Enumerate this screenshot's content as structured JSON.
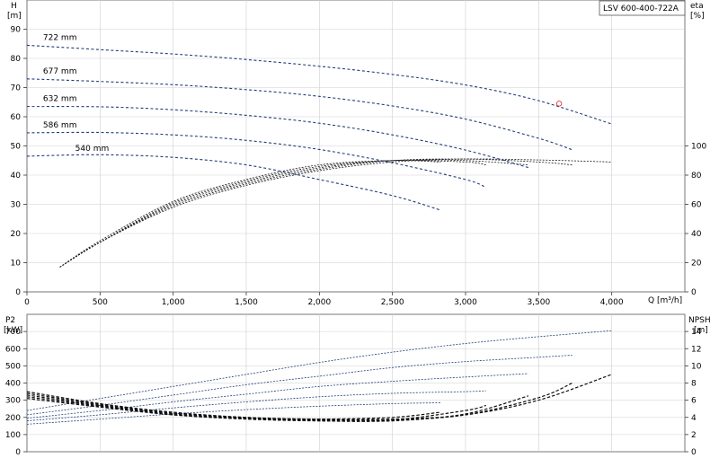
{
  "chart_data": [
    {
      "type": "line",
      "title": "LSV 600-400-722A",
      "ylabel_left": [
        "H",
        "[m]"
      ],
      "ylabel_right": [
        "eta",
        "[%]"
      ],
      "xlabel": "Q [m³/h]",
      "xlim": [
        0,
        4500
      ],
      "ylim_left": [
        0,
        100
      ],
      "ylim_right_ticks": [
        0,
        20,
        40,
        60,
        80,
        100
      ],
      "xticks": [
        0,
        500,
        1000,
        1500,
        2000,
        2500,
        3000,
        3500,
        4000
      ],
      "xtick_labels": [
        "0",
        "500",
        "1,000",
        "1,500",
        "2,000",
        "2,500",
        "3,000",
        "3,500",
        "4,000"
      ],
      "yticks_left": [
        0,
        10,
        20,
        30,
        40,
        50,
        60,
        70,
        80,
        90
      ],
      "grid": true,
      "head_series": [
        {
          "name": "722 mm",
          "color": "#1f3e7a",
          "x": [
            0,
            500,
            1000,
            1500,
            2000,
            2500,
            3000,
            3500,
            4000
          ],
          "y": [
            84.5,
            83.0,
            81.5,
            79.6,
            77.3,
            74.5,
            70.9,
            65.5,
            57.5
          ]
        },
        {
          "name": "677 mm",
          "color": "#1f3e7a",
          "x": [
            0,
            500,
            1000,
            1500,
            2000,
            2500,
            3000,
            3500,
            3730
          ],
          "y": [
            73.0,
            72.1,
            71.0,
            69.3,
            67.0,
            63.7,
            59.2,
            52.6,
            48.7
          ]
        },
        {
          "name": "632 mm",
          "color": "#1f3e7a",
          "x": [
            0,
            500,
            1000,
            1500,
            2000,
            2500,
            3000,
            3430
          ],
          "y": [
            63.5,
            63.4,
            62.4,
            60.5,
            57.8,
            53.8,
            48.6,
            42.6
          ]
        },
        {
          "name": "586 mm",
          "color": "#1f3e7a",
          "x": [
            0,
            500,
            1000,
            1500,
            2000,
            2500,
            3000,
            3140
          ],
          "y": [
            54.5,
            54.6,
            53.8,
            51.9,
            48.8,
            44.2,
            38.5,
            35.8
          ]
        },
        {
          "name": "540 mm",
          "color": "#1f3e7a",
          "x": [
            0,
            500,
            1000,
            1500,
            2000,
            2500,
            2830
          ],
          "y": [
            46.5,
            47.0,
            46.1,
            43.5,
            38.5,
            33.0,
            28.0
          ]
        }
      ],
      "eta_series": [
        {
          "x": [
            225,
            500,
            1000,
            1500,
            2000,
            2500,
            3000,
            3500,
            4000
          ],
          "y": [
            8.5,
            17,
            29,
            36.5,
            41.5,
            44.5,
            45.5,
            45.2,
            44.5
          ]
        },
        {
          "x": [
            225,
            500,
            1000,
            1500,
            2000,
            2500,
            3000,
            3500,
            3730
          ],
          "y": [
            8.5,
            17,
            29.5,
            37,
            42,
            45,
            45.5,
            44.5,
            43.5
          ]
        },
        {
          "x": [
            225,
            500,
            1000,
            1500,
            2000,
            2500,
            3000,
            3430
          ],
          "y": [
            8.5,
            17,
            30,
            37.5,
            42.5,
            45,
            45,
            43.5
          ]
        },
        {
          "x": [
            225,
            500,
            1000,
            1500,
            2000,
            2500,
            3000,
            3140
          ],
          "y": [
            8.5,
            17,
            30.5,
            38,
            43,
            45,
            44.5,
            43.5
          ]
        },
        {
          "x": [
            225,
            500,
            1000,
            1500,
            2000,
            2500,
            2830
          ],
          "y": [
            8.5,
            17.5,
            31,
            38.5,
            43.5,
            45,
            44.5
          ]
        }
      ],
      "annotations": [
        {
          "text": "o",
          "x": 3640,
          "y": 64.5,
          "color": "#e03030"
        }
      ]
    },
    {
      "type": "line",
      "ylabel_left": [
        "P2",
        "[kW]"
      ],
      "ylabel_right": [
        "NPSH",
        "[m]"
      ],
      "xlim": [
        0,
        4500
      ],
      "ylim_left": [
        0,
        800
      ],
      "ylim_right": [
        0,
        16
      ],
      "yticks_left": [
        0,
        100,
        200,
        300,
        400,
        500,
        600,
        700
      ],
      "yticks_right": [
        0,
        2,
        4,
        6,
        8,
        10,
        12,
        14
      ],
      "xticks": [
        0,
        500,
        1000,
        1500,
        2000,
        2500,
        3000,
        3500,
        4000
      ],
      "grid": true,
      "power_series": [
        {
          "color": "#1f3e7a",
          "x": [
            0,
            500,
            1000,
            1500,
            2000,
            2500,
            3000,
            3500,
            4000
          ],
          "y": [
            240,
            310,
            380,
            450,
            520,
            580,
            630,
            670,
            705
          ]
        },
        {
          "color": "#1f3e7a",
          "x": [
            0,
            500,
            1000,
            1500,
            2000,
            2500,
            3000,
            3500,
            3730
          ],
          "y": [
            215,
            270,
            330,
            390,
            440,
            490,
            525,
            550,
            562
          ]
        },
        {
          "color": "#1f3e7a",
          "x": [
            0,
            500,
            1000,
            1500,
            2000,
            2500,
            3000,
            3430
          ],
          "y": [
            195,
            240,
            290,
            335,
            380,
            410,
            435,
            455
          ]
        },
        {
          "color": "#1f3e7a",
          "x": [
            0,
            500,
            1000,
            1500,
            2000,
            2500,
            3000,
            3140
          ],
          "y": [
            180,
            215,
            255,
            290,
            320,
            340,
            350,
            355
          ]
        },
        {
          "color": "#1f3e7a",
          "x": [
            0,
            500,
            1000,
            1500,
            2000,
            2500,
            2830
          ],
          "y": [
            160,
            190,
            220,
            245,
            265,
            280,
            285
          ]
        }
      ],
      "npsh_series": [
        {
          "x": [
            0,
            500,
            1000,
            1500,
            2000,
            2500,
            3000,
            3500,
            4000
          ],
          "y": [
            7.0,
            5.6,
            4.6,
            4.0,
            3.8,
            3.8,
            4.3,
            6.0,
            9.0
          ]
        },
        {
          "x": [
            0,
            500,
            1000,
            1500,
            2000,
            2500,
            3000,
            3500,
            3730
          ],
          "y": [
            6.8,
            5.5,
            4.5,
            4.0,
            3.7,
            3.7,
            4.3,
            6.3,
            8.0
          ]
        },
        {
          "x": [
            0,
            500,
            1000,
            1500,
            2000,
            2500,
            3000,
            3430
          ],
          "y": [
            6.6,
            5.4,
            4.4,
            3.9,
            3.6,
            3.6,
            4.4,
            6.5
          ]
        },
        {
          "x": [
            0,
            500,
            1000,
            1500,
            2000,
            2500,
            3000,
            3140
          ],
          "y": [
            6.4,
            5.3,
            4.3,
            3.8,
            3.6,
            3.7,
            4.8,
            5.4
          ]
        },
        {
          "x": [
            0,
            500,
            1000,
            1500,
            2000,
            2500,
            2830
          ],
          "y": [
            6.2,
            5.2,
            4.3,
            3.9,
            3.8,
            4.0,
            4.6
          ]
        }
      ]
    }
  ]
}
